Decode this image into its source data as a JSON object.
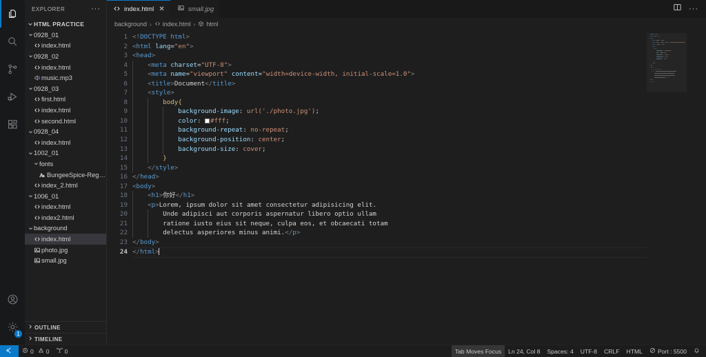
{
  "activitybar": {
    "items": [
      {
        "name": "explorer",
        "icon": "files-icon",
        "active": true
      },
      {
        "name": "search",
        "icon": "search-icon",
        "active": false
      },
      {
        "name": "source-control",
        "icon": "source-control-icon",
        "active": false
      },
      {
        "name": "run-and-debug",
        "icon": "run-debug-icon",
        "active": false
      },
      {
        "name": "extensions",
        "icon": "extensions-icon",
        "active": false
      }
    ],
    "bottom": [
      {
        "name": "accounts",
        "icon": "account-icon",
        "badge": ""
      },
      {
        "name": "manage",
        "icon": "gear-icon",
        "badge": "1"
      }
    ]
  },
  "sidebar": {
    "title": "EXPLORER",
    "more_actions": "···",
    "root_section": "HTML PRACTICE",
    "tree": [
      {
        "label": "0928_01",
        "type": "folder",
        "depth": 1,
        "expanded": true,
        "icon": "chevron-down-icon"
      },
      {
        "label": "index.html",
        "type": "html",
        "depth": 2,
        "icon": "html-file-icon"
      },
      {
        "label": "0928_02",
        "type": "folder",
        "depth": 1,
        "expanded": true,
        "icon": "chevron-down-icon"
      },
      {
        "label": "index.html",
        "type": "html",
        "depth": 2,
        "icon": "html-file-icon"
      },
      {
        "label": "music.mp3",
        "type": "audio",
        "depth": 2,
        "icon": "audio-file-icon"
      },
      {
        "label": "0928_03",
        "type": "folder",
        "depth": 1,
        "expanded": true,
        "icon": "chevron-down-icon"
      },
      {
        "label": "first.html",
        "type": "html",
        "depth": 2,
        "icon": "html-file-icon"
      },
      {
        "label": "index.html",
        "type": "html",
        "depth": 2,
        "icon": "html-file-icon"
      },
      {
        "label": "second.html",
        "type": "html",
        "depth": 2,
        "icon": "html-file-icon"
      },
      {
        "label": "0928_04",
        "type": "folder",
        "depth": 1,
        "expanded": true,
        "icon": "chevron-down-icon"
      },
      {
        "label": "index.html",
        "type": "html",
        "depth": 2,
        "icon": "html-file-icon"
      },
      {
        "label": "1002_01",
        "type": "folder",
        "depth": 1,
        "expanded": true,
        "icon": "chevron-down-icon"
      },
      {
        "label": "fonts",
        "type": "folder",
        "depth": 2,
        "expanded": true,
        "icon": "chevron-down-icon"
      },
      {
        "label": "BungeeSpice-Regu…",
        "type": "font",
        "depth": 3,
        "icon": "font-file-icon"
      },
      {
        "label": "index_2.html",
        "type": "html",
        "depth": 2,
        "icon": "html-file-icon"
      },
      {
        "label": "1006_01",
        "type": "folder",
        "depth": 1,
        "expanded": true,
        "icon": "chevron-down-icon"
      },
      {
        "label": "index.html",
        "type": "html",
        "depth": 2,
        "icon": "html-file-icon"
      },
      {
        "label": "index2.html",
        "type": "html",
        "depth": 2,
        "icon": "html-file-icon"
      },
      {
        "label": "background",
        "type": "folder",
        "depth": 1,
        "expanded": true,
        "icon": "chevron-down-icon"
      },
      {
        "label": "index.html",
        "type": "html",
        "depth": 2,
        "icon": "html-file-icon",
        "selected": true
      },
      {
        "label": "photo.jpg",
        "type": "image",
        "depth": 2,
        "icon": "image-file-icon"
      },
      {
        "label": "small.jpg",
        "type": "image",
        "depth": 2,
        "icon": "image-file-icon"
      }
    ],
    "panels": [
      {
        "label": "OUTLINE",
        "icon": "chevron-right-icon"
      },
      {
        "label": "TIMELINE",
        "icon": "chevron-right-icon"
      }
    ]
  },
  "editor": {
    "tabs": [
      {
        "label": "index.html",
        "icon": "html-file-icon",
        "active": true,
        "dirty": false,
        "close": "✕"
      },
      {
        "label": "small.jpg",
        "icon": "image-file-icon",
        "active": false,
        "preview": true
      }
    ],
    "actions": [
      {
        "name": "split-editor-icon"
      },
      {
        "name": "more-actions-icon",
        "label": "···"
      }
    ],
    "breadcrumb": [
      {
        "label": "background",
        "icon": ""
      },
      {
        "label": "index.html",
        "icon": "html-file-icon"
      },
      {
        "label": "html",
        "icon": "symbol-html-icon"
      }
    ],
    "breadcrumb_separator": "›",
    "line_count": 24,
    "current_line": 24,
    "lines": [
      {
        "n": 1,
        "tokens": [
          {
            "t": "brk",
            "v": "<!"
          },
          {
            "t": "tag",
            "v": "DOCTYPE"
          },
          {
            "t": "txt",
            "v": " "
          },
          {
            "t": "tag",
            "v": "html"
          },
          {
            "t": "brk",
            "v": ">"
          }
        ]
      },
      {
        "n": 2,
        "tokens": [
          {
            "t": "brk",
            "v": "<"
          },
          {
            "t": "tag",
            "v": "html"
          },
          {
            "t": "txt",
            "v": " "
          },
          {
            "t": "attr",
            "v": "lang"
          },
          {
            "t": "punc",
            "v": "="
          },
          {
            "t": "str",
            "v": "\"en\""
          },
          {
            "t": "brk",
            "v": ">"
          }
        ]
      },
      {
        "n": 3,
        "tokens": [
          {
            "t": "brk",
            "v": "<"
          },
          {
            "t": "tag",
            "v": "head"
          },
          {
            "t": "brk",
            "v": ">"
          }
        ]
      },
      {
        "n": 4,
        "indent": 1,
        "tokens": [
          {
            "t": "brk",
            "v": "<"
          },
          {
            "t": "tag",
            "v": "meta"
          },
          {
            "t": "txt",
            "v": " "
          },
          {
            "t": "attr",
            "v": "charset"
          },
          {
            "t": "punc",
            "v": "="
          },
          {
            "t": "str",
            "v": "\"UTF-8\""
          },
          {
            "t": "brk",
            "v": ">"
          }
        ]
      },
      {
        "n": 5,
        "indent": 1,
        "tokens": [
          {
            "t": "brk",
            "v": "<"
          },
          {
            "t": "tag",
            "v": "meta"
          },
          {
            "t": "txt",
            "v": " "
          },
          {
            "t": "attr",
            "v": "name"
          },
          {
            "t": "punc",
            "v": "="
          },
          {
            "t": "str",
            "v": "\"viewport\""
          },
          {
            "t": "txt",
            "v": " "
          },
          {
            "t": "attr",
            "v": "content"
          },
          {
            "t": "punc",
            "v": "="
          },
          {
            "t": "str",
            "v": "\"width=device-width, initial-scale=1.0\""
          },
          {
            "t": "brk",
            "v": ">"
          }
        ]
      },
      {
        "n": 6,
        "indent": 1,
        "tokens": [
          {
            "t": "brk",
            "v": "<"
          },
          {
            "t": "tag",
            "v": "title"
          },
          {
            "t": "brk",
            "v": ">"
          },
          {
            "t": "txt",
            "v": "Document"
          },
          {
            "t": "brk",
            "v": "</"
          },
          {
            "t": "tag",
            "v": "title"
          },
          {
            "t": "brk",
            "v": ">"
          }
        ]
      },
      {
        "n": 7,
        "indent": 1,
        "tokens": [
          {
            "t": "brk",
            "v": "<"
          },
          {
            "t": "tag",
            "v": "style"
          },
          {
            "t": "brk",
            "v": ">"
          }
        ]
      },
      {
        "n": 8,
        "indent": 2,
        "tokens": [
          {
            "t": "sel",
            "v": "body"
          },
          {
            "t": "brace",
            "v": "{"
          }
        ]
      },
      {
        "n": 9,
        "indent": 3,
        "tokens": [
          {
            "t": "prop",
            "v": "background-image"
          },
          {
            "t": "punc",
            "v": ": "
          },
          {
            "t": "val",
            "v": "url('./photo.jpg')"
          },
          {
            "t": "punc",
            "v": ";"
          }
        ]
      },
      {
        "n": 10,
        "indent": 3,
        "tokens": [
          {
            "t": "prop",
            "v": "color"
          },
          {
            "t": "punc",
            "v": ": "
          },
          {
            "t": "swatch",
            "v": "#ffffff"
          },
          {
            "t": "val",
            "v": "#fff"
          },
          {
            "t": "punc",
            "v": ";"
          }
        ]
      },
      {
        "n": 11,
        "indent": 3,
        "tokens": [
          {
            "t": "prop",
            "v": "background-repeat"
          },
          {
            "t": "punc",
            "v": ": "
          },
          {
            "t": "val",
            "v": "no-repeat"
          },
          {
            "t": "punc",
            "v": ";"
          }
        ]
      },
      {
        "n": 12,
        "indent": 3,
        "tokens": [
          {
            "t": "prop",
            "v": "background-position"
          },
          {
            "t": "punc",
            "v": ": "
          },
          {
            "t": "val",
            "v": "center"
          },
          {
            "t": "punc",
            "v": ";"
          }
        ]
      },
      {
        "n": 13,
        "indent": 3,
        "tokens": [
          {
            "t": "prop",
            "v": "background-size"
          },
          {
            "t": "punc",
            "v": ": "
          },
          {
            "t": "val",
            "v": "cover"
          },
          {
            "t": "punc",
            "v": ";"
          }
        ]
      },
      {
        "n": 14,
        "indent": 2,
        "tokens": [
          {
            "t": "brace",
            "v": "}"
          }
        ]
      },
      {
        "n": 15,
        "indent": 1,
        "tokens": [
          {
            "t": "brk",
            "v": "</"
          },
          {
            "t": "tag",
            "v": "style"
          },
          {
            "t": "brk",
            "v": ">"
          }
        ]
      },
      {
        "n": 16,
        "tokens": [
          {
            "t": "brk",
            "v": "</"
          },
          {
            "t": "tag",
            "v": "head"
          },
          {
            "t": "brk",
            "v": ">"
          }
        ]
      },
      {
        "n": 17,
        "tokens": [
          {
            "t": "brk",
            "v": "<"
          },
          {
            "t": "tag",
            "v": "body"
          },
          {
            "t": "brk",
            "v": ">"
          }
        ]
      },
      {
        "n": 18,
        "indent": 1,
        "tokens": [
          {
            "t": "brk",
            "v": "<"
          },
          {
            "t": "tag",
            "v": "h1"
          },
          {
            "t": "brk",
            "v": ">"
          },
          {
            "t": "txt",
            "v": "你好"
          },
          {
            "t": "brk",
            "v": "</"
          },
          {
            "t": "tag",
            "v": "h1"
          },
          {
            "t": "brk",
            "v": ">"
          }
        ]
      },
      {
        "n": 19,
        "indent": 1,
        "tokens": [
          {
            "t": "brk",
            "v": "<"
          },
          {
            "t": "tag",
            "v": "p"
          },
          {
            "t": "brk",
            "v": ">"
          },
          {
            "t": "txt",
            "v": "Lorem, ipsum dolor sit amet consectetur adipisicing elit."
          }
        ]
      },
      {
        "n": 20,
        "indent": 2,
        "tokens": [
          {
            "t": "txt",
            "v": "Unde adipisci aut corporis aspernatur libero optio ullam"
          }
        ]
      },
      {
        "n": 21,
        "indent": 2,
        "tokens": [
          {
            "t": "txt",
            "v": "ratione iusto eius sit neque, culpa eos, et obcaecati totam"
          }
        ]
      },
      {
        "n": 22,
        "indent": 2,
        "tokens": [
          {
            "t": "txt",
            "v": "delectus asperiores minus animi."
          },
          {
            "t": "brk",
            "v": "</"
          },
          {
            "t": "tag",
            "v": "p"
          },
          {
            "t": "brk",
            "v": ">"
          }
        ]
      },
      {
        "n": 23,
        "tokens": [
          {
            "t": "brk",
            "v": "</"
          },
          {
            "t": "tag",
            "v": "body"
          },
          {
            "t": "brk",
            "v": ">"
          }
        ]
      },
      {
        "n": 24,
        "tokens": [
          {
            "t": "brk",
            "v": "</"
          },
          {
            "t": "tag",
            "v": "html"
          },
          {
            "t": "brk",
            "v": ">"
          },
          {
            "t": "caret",
            "v": ""
          }
        ]
      }
    ]
  },
  "statusbar": {
    "remote_icon": "remote-window-icon",
    "left": [
      {
        "name": "problems",
        "icon": "error-icon",
        "errors": "0",
        "warn_icon": "warning-icon",
        "warnings": "0"
      },
      {
        "name": "ports",
        "icon": "radio-tower-icon",
        "label": "0"
      }
    ],
    "errors": "0",
    "warnings": "0",
    "ports_count": "0",
    "right": [
      {
        "name": "tab-moves-focus",
        "label": "Tab Moves Focus",
        "highlight": true
      },
      {
        "name": "editor-position",
        "label": "Ln 24, Col 8"
      },
      {
        "name": "editor-indentation",
        "label": "Spaces: 4"
      },
      {
        "name": "editor-encoding",
        "label": "UTF-8"
      },
      {
        "name": "editor-eol",
        "label": "CRLF"
      },
      {
        "name": "editor-language",
        "label": "HTML"
      },
      {
        "name": "live-server-port",
        "label": "Port : 5500",
        "icon": "broadcast-icon"
      },
      {
        "name": "notifications",
        "label": "",
        "icon": "bell-icon"
      }
    ]
  },
  "colors": {
    "accent": "#0a7aca",
    "editor_bg": "#1e1e1e",
    "sidebar_bg": "#1f1f20",
    "activitybar_bg": "#18191b",
    "tag": "#569cd6",
    "attr": "#9cdcfe",
    "string": "#ce9178",
    "selector": "#d7ba7d",
    "text": "#d4d4d4",
    "html_icon": "#e37933",
    "image_icon": "#a074c4",
    "audio_icon": "#a074c4",
    "font_icon": "#cc3e44"
  }
}
